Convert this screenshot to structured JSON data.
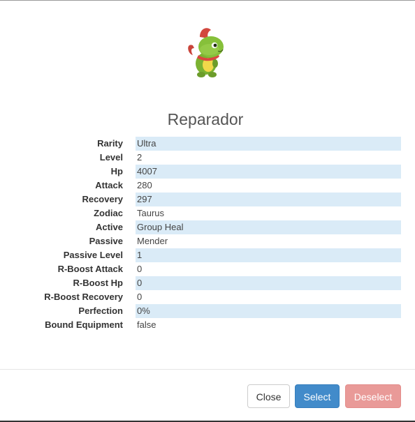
{
  "modal": {
    "title": "Reparador"
  },
  "stats": [
    {
      "label": "Rarity",
      "value": "Ultra"
    },
    {
      "label": "Level",
      "value": "2"
    },
    {
      "label": "Hp",
      "value": "4007"
    },
    {
      "label": "Attack",
      "value": "280"
    },
    {
      "label": "Recovery",
      "value": "297"
    },
    {
      "label": "Zodiac",
      "value": "Taurus"
    },
    {
      "label": "Active",
      "value": "Group Heal"
    },
    {
      "label": "Passive",
      "value": "Mender"
    },
    {
      "label": "Passive Level",
      "value": "1"
    },
    {
      "label": "R-Boost Attack",
      "value": "0"
    },
    {
      "label": "R-Boost Hp",
      "value": "0"
    },
    {
      "label": "R-Boost Recovery",
      "value": "0"
    },
    {
      "label": "Perfection",
      "value": "0%"
    },
    {
      "label": "Bound Equipment",
      "value": "false"
    }
  ],
  "footer": {
    "close_label": "Close",
    "select_label": "Select",
    "deselect_label": "Deselect"
  },
  "colors": {
    "stripe": "#daebf7",
    "select_button": "#428bca",
    "deselect_button": "#e99a98"
  },
  "icons": {
    "creature": "green-chameleon-creature-icon"
  }
}
